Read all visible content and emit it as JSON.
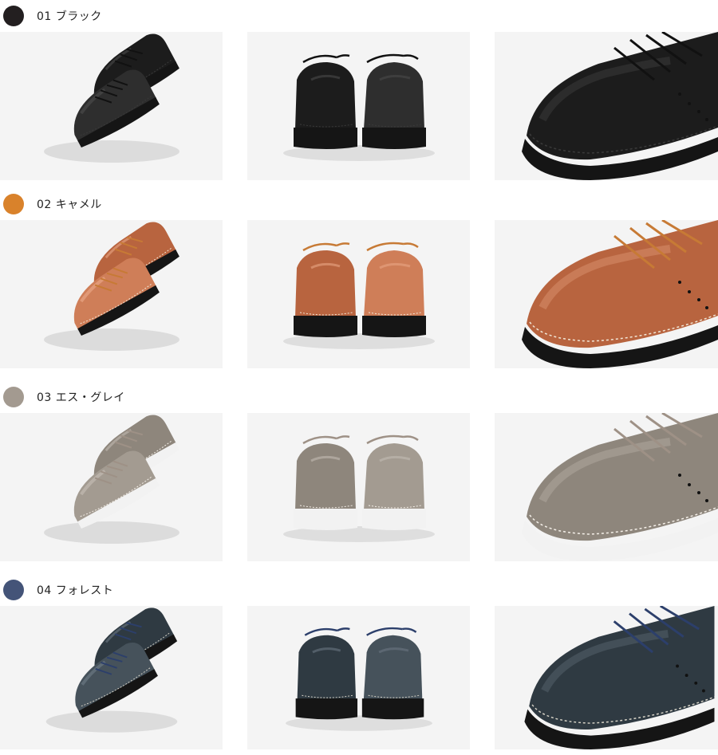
{
  "colors": [
    {
      "id": "01",
      "name": "ブラック",
      "label": "01 ブラック",
      "swatch": "#231f20",
      "leather": "#1c1c1c",
      "leather_mid": "#2e2e2e",
      "leather_hi": "#4a4a4a",
      "lace": "#111111",
      "sole": "#151515",
      "stitch": "#3a3a3a"
    },
    {
      "id": "02",
      "name": "キャメル",
      "label": "02 キャメル",
      "swatch": "#d9822b",
      "leather": "#b8643f",
      "leather_mid": "#cf7e58",
      "leather_hi": "#e8a584",
      "lace": "#c77a35",
      "sole": "#151515",
      "stitch": "#f1e6d6"
    },
    {
      "id": "03",
      "name": "エス・グレイ",
      "label": "03 エス・グレイ",
      "swatch": "#a39a90",
      "leather": "#8e867c",
      "leather_mid": "#a39b91",
      "leather_hi": "#c2bbb2",
      "lace": "#9e9186",
      "sole": "#f2f2f2",
      "stitch": "#f4efe8"
    },
    {
      "id": "04",
      "name": "フォレスト",
      "label": "04 フォレスト",
      "swatch": "#445478",
      "leather": "#2f3a42",
      "leather_mid": "#46525b",
      "leather_hi": "#6a7782",
      "lace": "#2c3f6b",
      "sole": "#151515",
      "stitch": "#d8d4c8"
    }
  ],
  "photos": {
    "pair_view": "shoe-pair-angle-photo",
    "back_view": "shoe-back-photo",
    "toe_view": "shoe-toe-closeup-photo"
  }
}
